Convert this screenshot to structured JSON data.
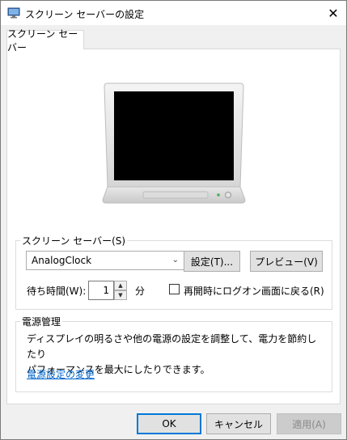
{
  "window": {
    "title": "スクリーン セーバーの設定",
    "close_glyph": "✕"
  },
  "tabs": [
    {
      "label": "スクリーン セーバー",
      "active": true
    }
  ],
  "screensaver_group": {
    "label": "スクリーン セーバー(S)",
    "selected": "AnalogClock",
    "settings_button": "設定(T)...",
    "preview_button": "プレビュー(V)",
    "wait_label": "待ち時間(W):",
    "wait_value": "1",
    "wait_unit": "分",
    "resume_logon_label": "再開時にログオン画面に戻る(R)",
    "resume_logon_checked": false
  },
  "power_group": {
    "label": "電源管理",
    "description_line1": "ディスプレイの明るさや他の電源の設定を調整して、電力を節約したり",
    "description_line2": "パフォーマンスを最大にしたりできます。",
    "link": "電源設定の変更"
  },
  "footer": {
    "ok": "OK",
    "cancel": "キャンセル",
    "apply": "適用(A)"
  },
  "colors": {
    "link": "#0066cc",
    "accent": "#0078d7",
    "monitor_screen": "#000000"
  }
}
